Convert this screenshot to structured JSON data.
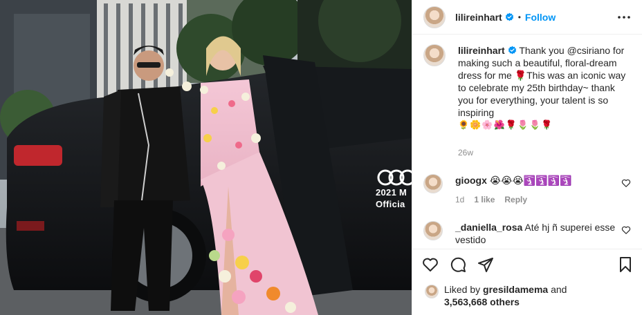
{
  "photo": {
    "alt_icons": [
      "car",
      "people"
    ],
    "car_brand_line1": "2021 M",
    "car_brand_line2": "Officia"
  },
  "header": {
    "username": "lilireinhart",
    "separator": "•",
    "follow_label": "Follow",
    "verified_icon": "verified-badge-icon",
    "more_icon": "more-horizontal-icon"
  },
  "caption": {
    "username": "lilireinhart",
    "text": "Thank you @csiriano for making such a beautiful, floral-dream dress for me 🌹This was an iconic way to celebrate my 25th birthday~ thank you for everything, your talent is so inspiring",
    "emojis": "🌻🌼🌸🌺🌹🌷🌷🌹",
    "age": "26w"
  },
  "comments": [
    {
      "username": "gioogx",
      "text": "😭😭😭🛐🛐🛐🛐",
      "time": "1d",
      "likes": "1 like",
      "reply": "Reply"
    },
    {
      "username": "_daniella_rosa",
      "text": "Até hj ñ superei esse vestido",
      "time": "",
      "likes": "",
      "reply": ""
    }
  ],
  "likes": {
    "prefix": "Liked by",
    "by_user": "gresildamema",
    "and": "and",
    "others": "3,563,668 others"
  },
  "colors": {
    "accent": "#0095f6",
    "text": "#262626",
    "muted": "#8e8e8e",
    "border": "#efefef"
  }
}
